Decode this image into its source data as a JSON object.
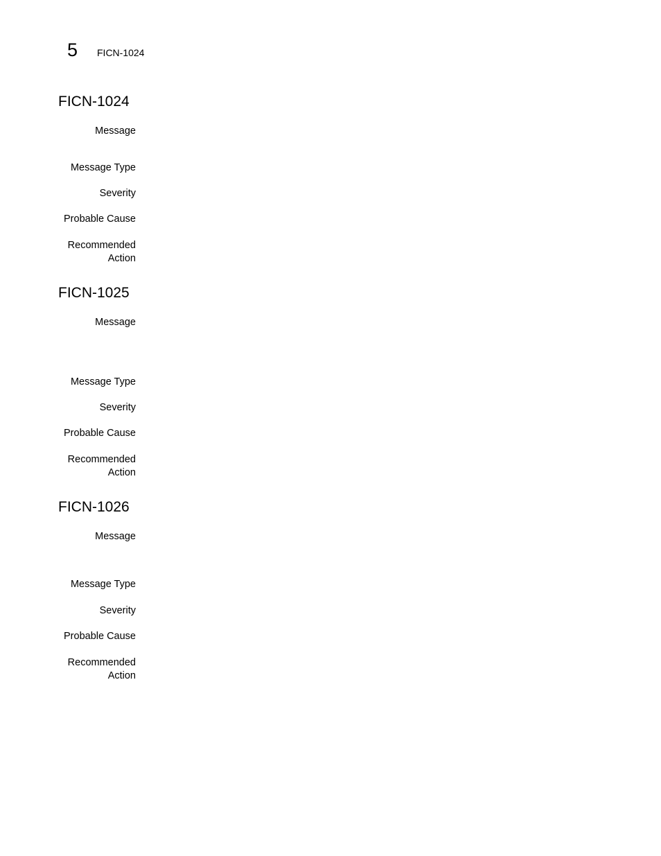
{
  "header": {
    "chapter_number": "5",
    "running_title": "FICN-1024"
  },
  "sections": [
    {
      "title": "FICN-1024",
      "fields": [
        {
          "label": "Message",
          "value": ""
        },
        {
          "label": "Message Type",
          "value": ""
        },
        {
          "label": "Severity",
          "value": ""
        },
        {
          "label": "Probable Cause",
          "value": ""
        },
        {
          "label": "Recommended Action",
          "value": ""
        }
      ]
    },
    {
      "title": "FICN-1025",
      "fields": [
        {
          "label": "Message",
          "value": ""
        },
        {
          "label": "Message Type",
          "value": ""
        },
        {
          "label": "Severity",
          "value": ""
        },
        {
          "label": "Probable Cause",
          "value": ""
        },
        {
          "label": "Recommended Action",
          "value": ""
        }
      ]
    },
    {
      "title": "FICN-1026",
      "fields": [
        {
          "label": "Message",
          "value": ""
        },
        {
          "label": "Message Type",
          "value": ""
        },
        {
          "label": "Severity",
          "value": ""
        },
        {
          "label": "Probable Cause",
          "value": ""
        },
        {
          "label": "Recommended Action",
          "value": ""
        }
      ]
    }
  ]
}
